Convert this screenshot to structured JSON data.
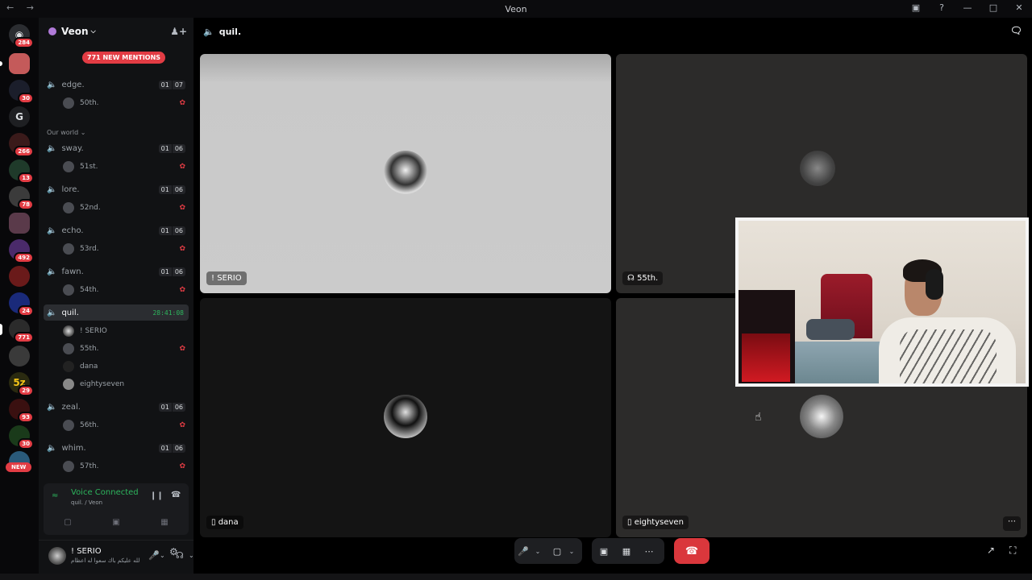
{
  "window": {
    "title": "Veon",
    "controls": [
      "minimize",
      "maximize",
      "close"
    ]
  },
  "guild_bar": {
    "items": [
      {
        "name": "discord-home",
        "badge": "284",
        "letter": ""
      },
      {
        "name": "guild-1",
        "badge": "",
        "letter": ""
      },
      {
        "name": "guild-2",
        "badge": "30",
        "letter": ""
      },
      {
        "name": "guild-g",
        "badge": "",
        "letter": "G"
      },
      {
        "name": "guild-4",
        "badge": "266",
        "letter": ""
      },
      {
        "name": "guild-5",
        "badge": "13",
        "letter": ""
      },
      {
        "name": "guild-6",
        "badge": "78",
        "letter": ""
      },
      {
        "name": "guild-7",
        "badge": "",
        "letter": ""
      },
      {
        "name": "guild-8",
        "badge": "492",
        "letter": ""
      },
      {
        "name": "guild-9",
        "badge": "",
        "letter": ""
      },
      {
        "name": "guild-10",
        "badge": "24",
        "letter": ""
      },
      {
        "name": "guild-veon",
        "badge": "771",
        "letter": ""
      },
      {
        "name": "guild-12",
        "badge": "",
        "letter": ""
      },
      {
        "name": "guild-13",
        "badge": "29",
        "letter": ""
      },
      {
        "name": "guild-14",
        "badge": "93",
        "letter": ""
      },
      {
        "name": "guild-15",
        "badge": "30",
        "letter": ""
      }
    ],
    "new_label": "NEW"
  },
  "sidebar": {
    "server_name": "Veon",
    "mentions_pill": "771 NEW MENTIONS",
    "category": "Our world",
    "channels": [
      {
        "name": "edge.",
        "counts": [
          "01",
          "07"
        ],
        "member": "50th."
      },
      {
        "name": "sway.",
        "counts": [
          "01",
          "06"
        ],
        "member": "51st."
      },
      {
        "name": "lore.",
        "counts": [
          "01",
          "06"
        ],
        "member": "52nd."
      },
      {
        "name": "echo.",
        "counts": [
          "01",
          "06"
        ],
        "member": "53rd."
      },
      {
        "name": "fawn.",
        "counts": [
          "01",
          "06"
        ],
        "member": "54th."
      },
      {
        "name": "zeal.",
        "counts": [
          "01",
          "06"
        ],
        "member": "56th."
      },
      {
        "name": "whim.",
        "counts": [
          "01",
          "06"
        ],
        "member": "57th."
      }
    ],
    "active_channel": {
      "name": "quil.",
      "timer": "28:41:08",
      "members": [
        "! SERIO",
        "55th.",
        "dana",
        "eightyseven"
      ]
    }
  },
  "voice_panel": {
    "title": "Voice Connected",
    "subtitle": "quil. / Veon"
  },
  "user_panel": {
    "name": "! SERIO",
    "status": "الله عليكم باك سعوا له اعظام"
  },
  "stage": {
    "channel_name": "quil.",
    "tiles": [
      {
        "label": "! SERIO"
      },
      {
        "label": "55th."
      },
      {
        "label": "dana"
      },
      {
        "label": "eightyseven"
      }
    ]
  },
  "colors": {
    "accent_green": "#2db55d",
    "danger_red": "#da373c",
    "badge_red": "#e23c44"
  }
}
